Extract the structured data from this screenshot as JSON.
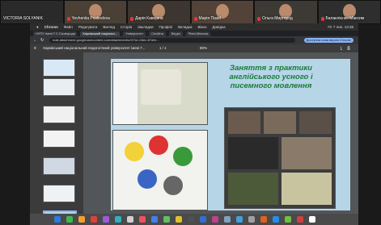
{
  "participants": [
    {
      "name": "VICTORIA SOLYANIK",
      "muted": false,
      "bg": "#2a2a2a"
    },
    {
      "name": "Yevheniia Posliedova",
      "muted": true,
      "bg": "#4a4036"
    },
    {
      "name": "Дарія Каверіна",
      "muted": true,
      "bg": "#3c3530"
    },
    {
      "name": "Марія Пазій",
      "muted": true,
      "bg": "#524238"
    },
    {
      "name": "Ольга Миргород",
      "muted": true,
      "bg": "#3d3a36"
    },
    {
      "name": "Балаклієнко Максим",
      "muted": true,
      "bg": "#2e2e2e"
    }
  ],
  "menubar": {
    "items": [
      "Chrome",
      "Файл",
      "Редагувати",
      "Вигляд",
      "Історія",
      "Закладки",
      "Профілі",
      "Вкладка",
      "Вікно",
      "Довідка"
    ],
    "clock": "Пт 7 лип. 13:38"
  },
  "tabs": [
    "НУПУ імені Г.С.Сковороди",
    "Харківський націонал...",
    "Університет",
    "Сесійна",
    "Вхідні",
    "Рівні-Мінєска"
  ],
  "address": {
    "url": "mail-attachment.googleusercontent.com/attachment/u/0/?ui=2&ik=87a9c...",
    "update_label": "Доступна нова версія Chrome"
  },
  "viewer": {
    "title": "Харківський національний педагогічний університет імені Г...",
    "page": "1 / 1",
    "zoom": "80%"
  },
  "slide": {
    "heading": "Заняття з практики англійського усного і писемного мовлення",
    "accent_color": "#1b7a3a"
  },
  "colors": {
    "slide_bg": "#b6d6e8",
    "toolbar": "#3c3c3c"
  }
}
